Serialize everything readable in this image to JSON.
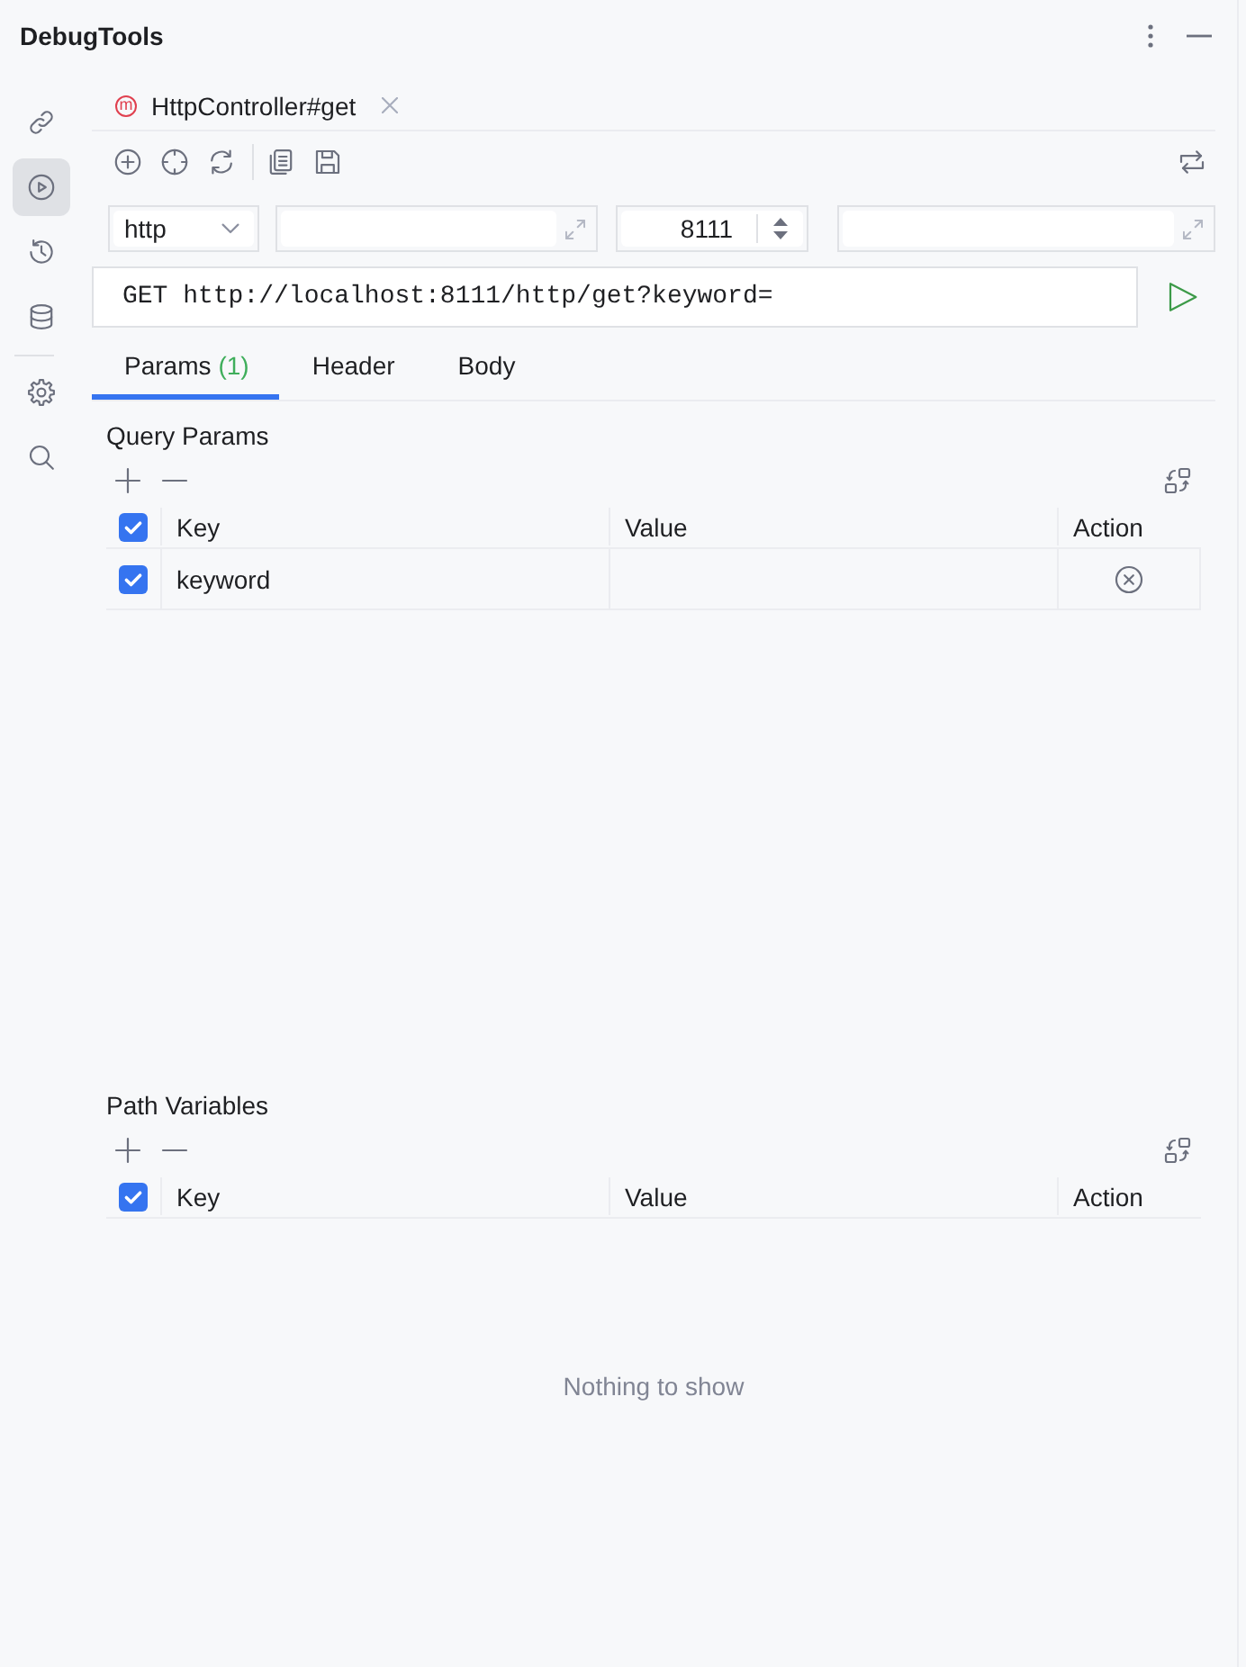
{
  "panel": {
    "title": "DebugTools"
  },
  "sidebar": {
    "groups": [
      {
        "items": [
          {
            "kind": "link",
            "selected": false
          },
          {
            "kind": "run",
            "selected": true
          },
          {
            "kind": "history",
            "selected": false
          },
          {
            "kind": "database",
            "selected": false
          }
        ]
      },
      {
        "items": [
          {
            "kind": "settings",
            "selected": false
          },
          {
            "kind": "search",
            "selected": false
          }
        ]
      }
    ]
  },
  "editor_tabs": [
    {
      "badge": "m",
      "label": "HttpController#get"
    }
  ],
  "toolbar": {
    "left": [
      {
        "kind": "add"
      },
      {
        "kind": "locate"
      },
      {
        "kind": "refresh"
      },
      {
        "kind": "separator"
      },
      {
        "kind": "copy"
      },
      {
        "kind": "save"
      }
    ],
    "right": [
      {
        "kind": "swap"
      }
    ]
  },
  "request": {
    "protocol": "http",
    "port": "8111",
    "url": "GET http://localhost:8111/http/get?keyword="
  },
  "request_tabs": [
    {
      "label": "Params",
      "count": "(1)",
      "selected": true
    },
    {
      "label": "Header",
      "selected": false
    },
    {
      "label": "Body",
      "selected": false
    }
  ],
  "query_params": {
    "title": "Query Params",
    "columns": [
      "Key",
      "Value",
      "Action"
    ],
    "all_checked": true,
    "rows": [
      {
        "checked": true,
        "key": "keyword"
      }
    ]
  },
  "path_variables": {
    "title": "Path Variables",
    "columns": [
      "Key",
      "Value",
      "Action"
    ],
    "all_checked": true,
    "empty_text": "Nothing to show"
  }
}
